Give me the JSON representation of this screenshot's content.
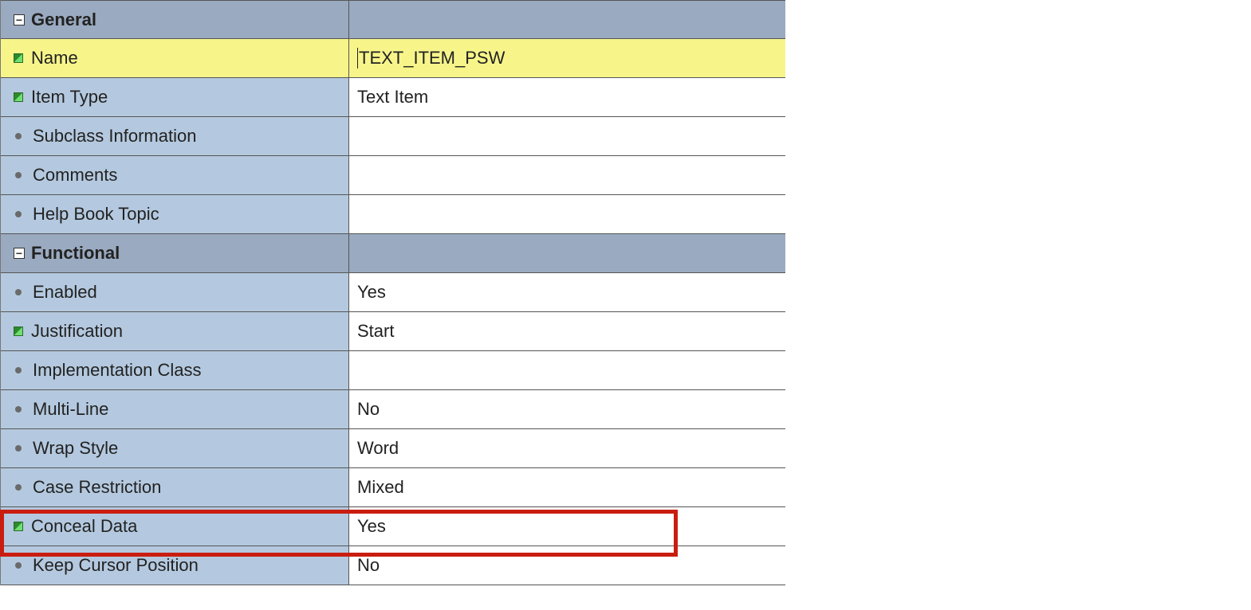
{
  "sections": {
    "general": {
      "title": "General",
      "rows": {
        "name": {
          "label": "Name",
          "value": "TEXT_ITEM_PSW",
          "icon": "mod",
          "active": true
        },
        "item_type": {
          "label": "Item Type",
          "value": "Text Item",
          "icon": "mod"
        },
        "subclass": {
          "label": "Subclass Information",
          "value": "",
          "icon": "def"
        },
        "comments": {
          "label": "Comments",
          "value": "",
          "icon": "def"
        },
        "help_book": {
          "label": "Help Book Topic",
          "value": "",
          "icon": "def"
        }
      }
    },
    "functional": {
      "title": "Functional",
      "rows": {
        "enabled": {
          "label": "Enabled",
          "value": "Yes",
          "icon": "def"
        },
        "justification": {
          "label": "Justification",
          "value": "Start",
          "icon": "mod"
        },
        "impl_class": {
          "label": "Implementation Class",
          "value": "",
          "icon": "def"
        },
        "multi_line": {
          "label": "Multi-Line",
          "value": "No",
          "icon": "def"
        },
        "wrap_style": {
          "label": "Wrap Style",
          "value": "Word",
          "icon": "def"
        },
        "case_restrict": {
          "label": "Case Restriction",
          "value": "Mixed",
          "icon": "def"
        },
        "conceal_data": {
          "label": "Conceal Data",
          "value": "Yes",
          "icon": "mod",
          "highlight": true
        },
        "keep_cursor": {
          "label": "Keep Cursor Position",
          "value": "No",
          "icon": "def"
        }
      }
    }
  },
  "collapse_glyph": "−"
}
